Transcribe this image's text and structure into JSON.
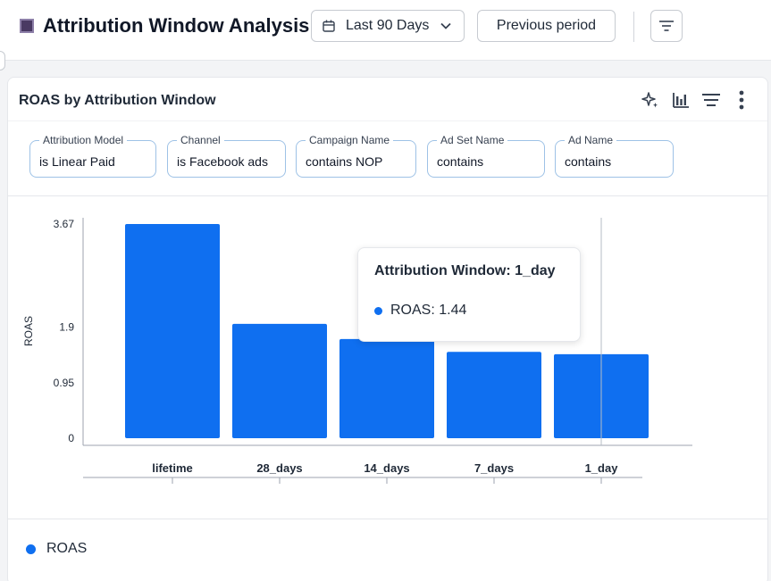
{
  "header": {
    "title": "Attribution Window Analysis",
    "date_range": "Last 90 Days",
    "compare": "Previous period"
  },
  "card": {
    "title": "ROAS by Attribution Window",
    "filters": [
      {
        "label": "Attribution Model",
        "value": "is  Linear Paid"
      },
      {
        "label": "Channel",
        "value": "is  Facebook ads"
      },
      {
        "label": "Campaign Name",
        "value": "contains  NOP"
      },
      {
        "label": "Ad Set Name",
        "value": "contains"
      },
      {
        "label": "Ad Name",
        "value": "contains"
      }
    ]
  },
  "tooltip": {
    "title": "Attribution Window: 1_day",
    "series": "ROAS",
    "value": "1.44",
    "row": "ROAS: 1.44"
  },
  "colors": {
    "bar": "#0f6ff0",
    "accent_square": "#4a3a63"
  },
  "chart_data": {
    "type": "bar",
    "categories": [
      "lifetime",
      "28_days",
      "14_days",
      "7_days",
      "1_day"
    ],
    "series": [
      {
        "name": "ROAS",
        "values": [
          3.67,
          1.96,
          1.7,
          1.48,
          1.44
        ]
      }
    ],
    "ylabel": "ROAS",
    "xlabel": "",
    "yticks": [
      0,
      0.95,
      1.9,
      3.67
    ],
    "ylim": [
      0,
      3.67
    ],
    "highlight_category": "1_day",
    "legend": "bottom-left"
  }
}
